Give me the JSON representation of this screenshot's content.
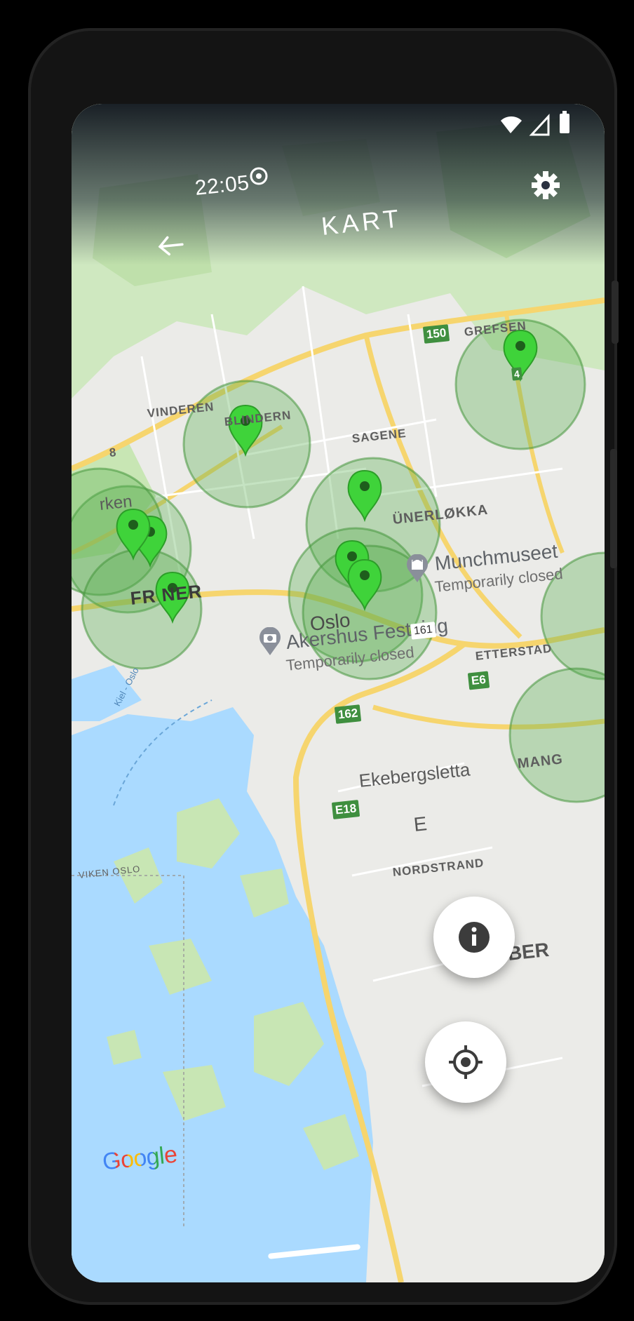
{
  "status_bar": {
    "time": "22:05"
  },
  "app_bar": {
    "title": "KART"
  },
  "map": {
    "districts": {
      "grefsen": "GREFSEN",
      "vinderen": "VINDEREN",
      "blindern": "BLINDERN",
      "sagene": "SAGENE",
      "grunerlokka": "ÜNERLØKKA",
      "frogner": "FR   NER",
      "etterstad": "ETTERSTAD",
      "ekebergsletta": "Ekebergsletta",
      "nordstrand": "NORDSTRAND",
      "manglerud": "MANG",
      "viken_oslo": "VIKEN  OSLO",
      "partial_west": "rken",
      "partial_e": "E",
      "partial_ber": "BER",
      "partial_8": "8"
    },
    "city": "Oslo",
    "places": [
      {
        "name": "Munchmuseet",
        "status": "Temporarily closed"
      },
      {
        "name": "Akershus Festning",
        "status": "Temporarily closed"
      }
    ],
    "road_badges": {
      "r150": "150",
      "r161": "161",
      "e6": "E6",
      "r162": "162",
      "e18": "E18"
    },
    "ferry_route": "Kiel - Oslo",
    "cluster_count": "4",
    "attribution": "Google"
  },
  "colors": {
    "water": "#aadaff",
    "park": "#c8e6b4",
    "road_major": "#f9d97a",
    "marker_green": "#3fd33a",
    "circle_fill": "rgba(80,170,70,0.35)"
  },
  "icons": {
    "back": "arrow-left-icon",
    "settings": "gear-icon",
    "info": "info-icon",
    "locate": "gps-target-icon",
    "museum": "museum-icon",
    "camera": "camera-icon"
  }
}
